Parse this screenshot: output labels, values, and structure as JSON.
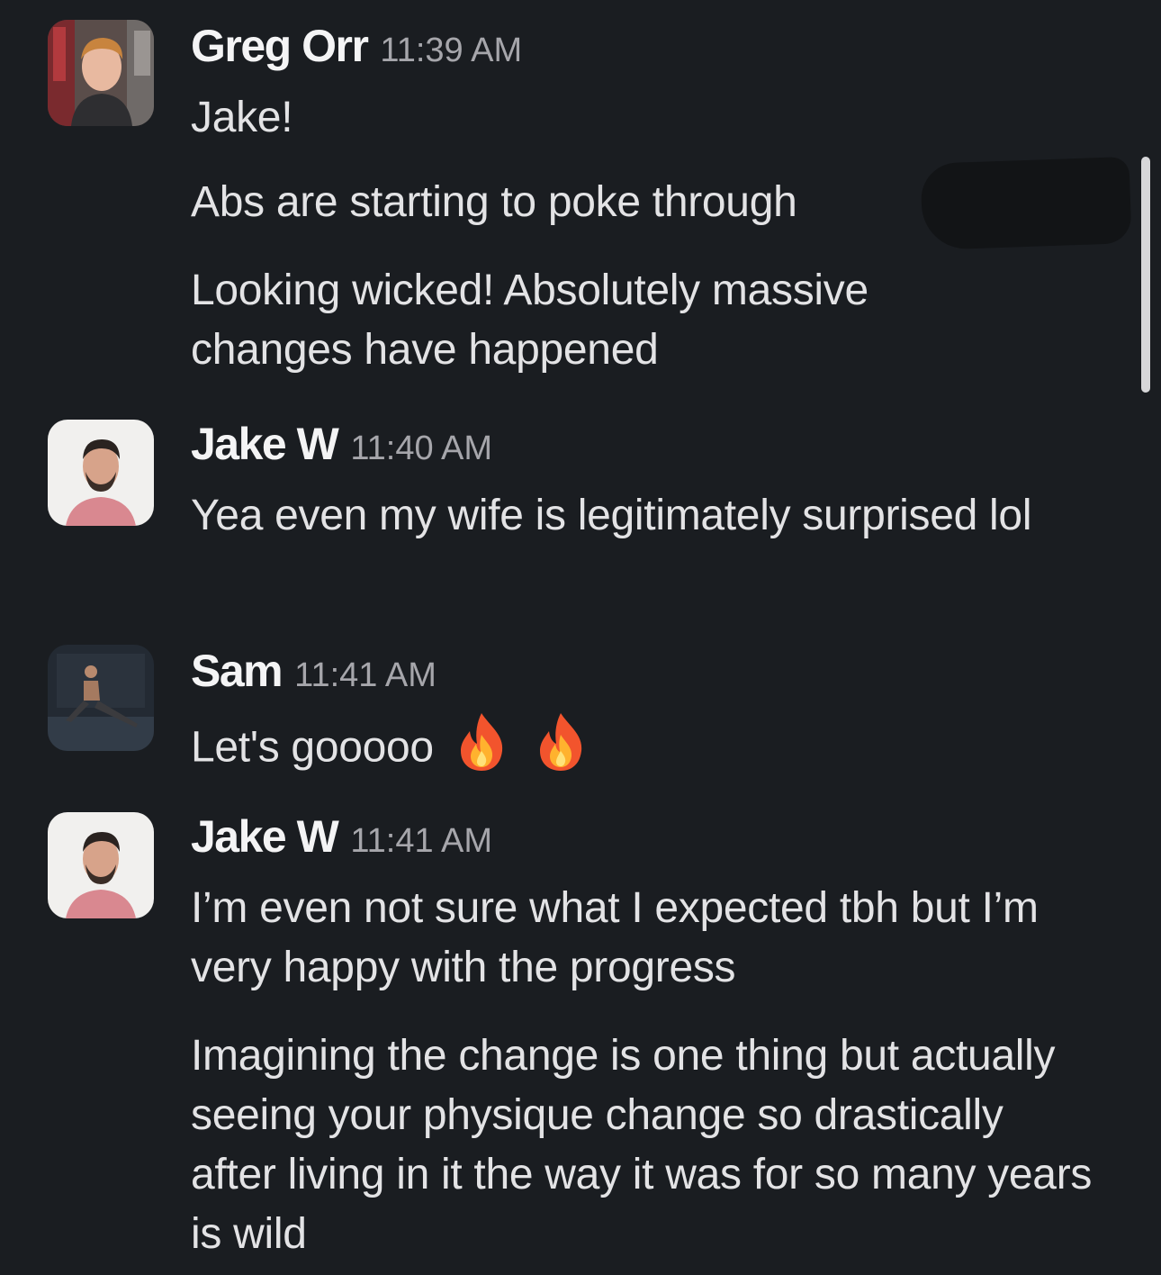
{
  "messages": [
    {
      "author": "Greg Orr",
      "time": "11:39 AM",
      "avatar": "greg-avatar",
      "lines": [
        "Jake!",
        "Abs are starting to poke through",
        "Looking wicked! Absolutely massive changes have happened"
      ]
    },
    {
      "author": "Jake W",
      "time": "11:40 AM",
      "avatar": "jake-avatar",
      "lines": [
        "Yea even my wife is legitimately surprised lol"
      ]
    },
    {
      "author": "Sam",
      "time": "11:41 AM",
      "avatar": "sam-avatar",
      "lines": [
        "Let's gooooo"
      ],
      "emoji": [
        "fire-emoji",
        "fire-emoji"
      ]
    },
    {
      "author": "Jake W",
      "time": "11:41 AM",
      "avatar": "jake-avatar",
      "lines": [
        "I’m even not sure what I expected tbh but I’m very happy with the progress",
        "Imagining the change is one thing but actually seeing your physique change so drastically after living in it the way it was for so many years is wild"
      ]
    }
  ],
  "colors": {
    "background": "#1a1d21",
    "text": "#e3e3e5",
    "timestamp": "#a6a6ab"
  }
}
